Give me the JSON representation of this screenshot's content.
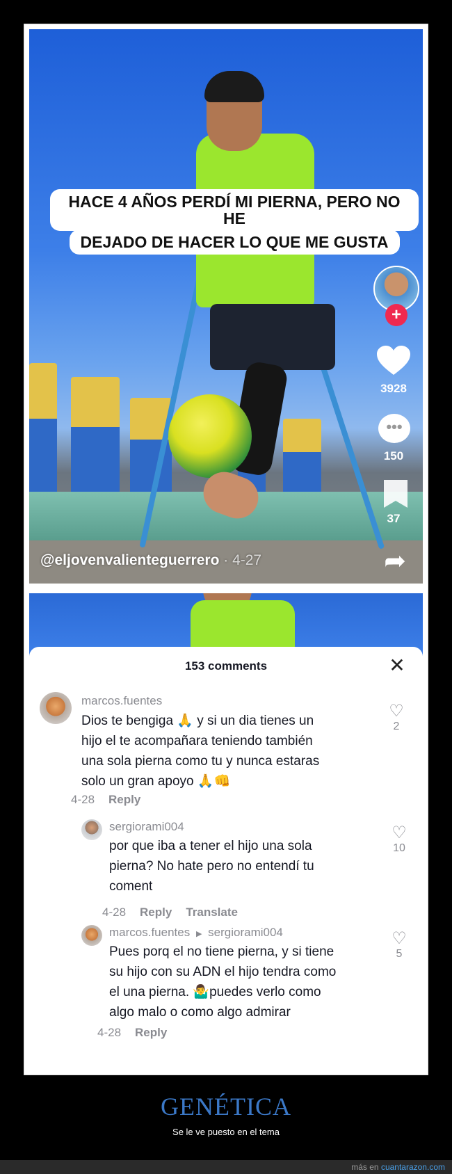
{
  "video": {
    "caption_line1": "HACE 4 AÑOS PERDÍ MI PIERNA, PERO NO HE",
    "caption_line2": "DEJADO DE HACER LO QUE ME GUSTA",
    "username": "@eljovenvalienteguerrero",
    "date": "· 4-27",
    "likes": "3928",
    "comments": "150",
    "saves": "37",
    "follow_plus": "+"
  },
  "comments_panel": {
    "title": "153 comments",
    "close": "✕",
    "items": [
      {
        "user": "marcos.fuentes",
        "text_lines": [
          "Dios te bengiga 🙏 y si un dia tienes un",
          "hijo el te acompañara teniendo también",
          "una sola pierna como tu y nunca estaras",
          "solo un gran apoyo 🙏👊"
        ],
        "date": "4-28",
        "reply": "Reply",
        "likes": "2"
      },
      {
        "user": "sergiorami004",
        "text_lines": [
          "por que iba a tener el hijo una sola",
          "pierna? No hate pero no entendí tu",
          "coment"
        ],
        "date": "4-28",
        "reply": "Reply",
        "translate": "Translate",
        "likes": "10"
      },
      {
        "user": "marcos.fuentes",
        "reply_to": "sergiorami004",
        "text_lines": [
          "Pues porq el no tiene pierna, y si tiene",
          "su hijo con su ADN el hijo tendra como",
          "el una pierna. 🤷‍♂️puedes verlo como",
          "algo malo o como algo admirar"
        ],
        "date": "4-28",
        "reply": "Reply",
        "likes": "5"
      }
    ]
  },
  "page": {
    "title": "GENÉTICA",
    "subtitle": "Se le ve puesto en el tema",
    "footer_prefix": "más en ",
    "footer_link": "cuantarazon.com"
  },
  "colors": {
    "accent_blue": "#3b78c7",
    "tiktok_red": "#ef2950"
  }
}
